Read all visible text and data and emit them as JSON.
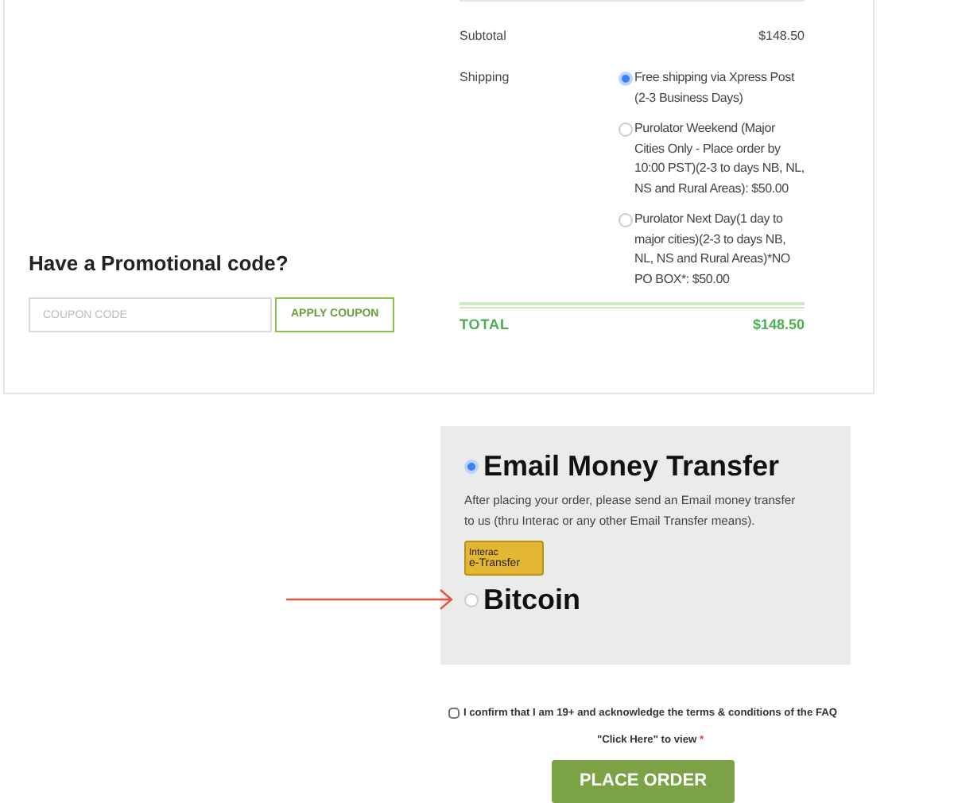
{
  "totals": {
    "subtotal_label": "Subtotal",
    "subtotal_value": "$148.50",
    "shipping_label": "Shipping",
    "shipping_options": [
      {
        "label": "Free shipping via Xpress Post (2-3 Business Days)",
        "selected": true
      },
      {
        "label": "Purolator Weekend (Major Cities Only - Place order by 10:00 PST)(2-3 to days NB, NL, NS and Rural Areas): $50.00",
        "selected": false
      },
      {
        "label": "Purolator Next Day(1 day to major cities)(2-3 to days NB, NL, NS and Rural Areas)*NO PO BOX*: $50.00",
        "selected": false
      }
    ],
    "total_label": "TOTAL",
    "total_value": "$148.50"
  },
  "coupon": {
    "heading": "Have a Promotional code?",
    "placeholder": "COUPON CODE",
    "button": "APPLY COUPON"
  },
  "payment_methods": [
    {
      "title": "Email Money Transfer",
      "selected": true,
      "description": "After placing your order, please send an Email money transfer to us (thru Interac or any other Email Transfer means).",
      "logo_small": "Interac",
      "logo_text": "e-Transfer"
    },
    {
      "title": "Bitcoin",
      "selected": false
    }
  ],
  "terms": {
    "checked": false,
    "text": "I confirm that I am 19+ and acknowledge the terms & conditions of the FAQ \"Click Here\" to view",
    "required_mark": "*"
  },
  "place_order": "PLACE ORDER"
}
